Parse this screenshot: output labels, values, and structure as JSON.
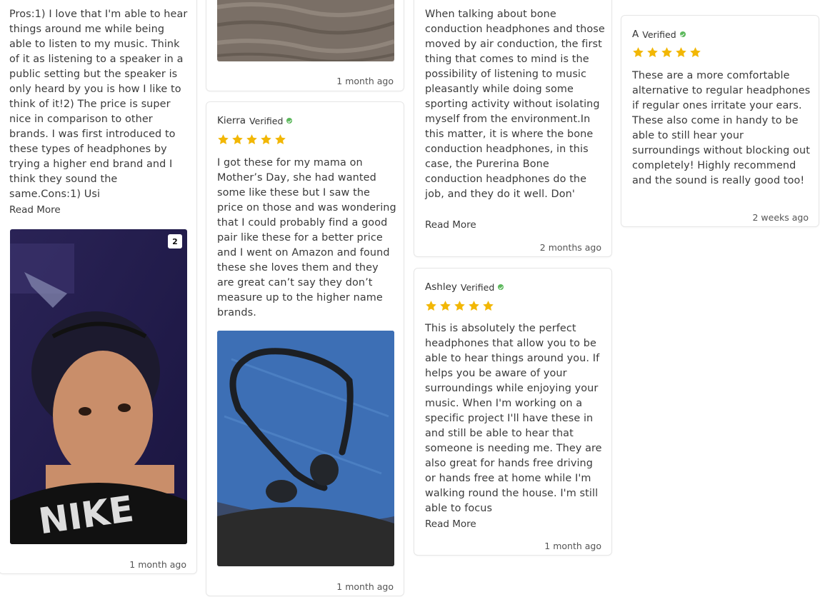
{
  "colors": {
    "star": "#f2b705",
    "verified": "#5cb85c",
    "border": "#e6e6e6"
  },
  "reviews": [
    {
      "text": "Pros:1) I love that I'm able to hear things around me while being able to listen to my music. Think of it as listening to a speaker in a public setting but the speaker is only heard by you is how I like to think of it!2) The price is super nice in comparison to other brands. I was first introduced to these types of headphones by trying a higher end brand and I think they sound the same.Cons:1) Usi",
      "read_more": "Read More",
      "photo_count": "2",
      "date": "1 month ago"
    },
    {
      "date": "1 month ago"
    },
    {
      "author": "Kierra",
      "verified": "Verified",
      "rating": 5,
      "text": "I got these for my mama on Mother’s Day, she had wanted some like these but I saw the price on those and was wondering that I could probably find a good pair like these for a better price and I went on Amazon and found these she loves them and they are great can’t say they don’t measure up to the higher name brands.",
      "date": "1 month ago"
    },
    {
      "text": "When talking about bone conduction headphones and those moved by air conduction, the first thing that comes to mind is the possibility of listening to music pleasantly while doing some sporting activity without isolating myself from the environment.In this matter, it is where the bone conduction headphones, in this case, the Purerina Bone conduction headphones do the job, and they do it well. Don'",
      "read_more": "Read More",
      "date": "2 months ago"
    },
    {
      "author": "Ashley",
      "verified": "Verified",
      "rating": 5,
      "text": "This is absolutely the perfect headphones that allow you to be able to hear things around you. If helps you be aware of your surroundings while enjoying your music. When I'm working on a specific project I'll have these in and still be able to hear that someone is needing me. They are also great for hands free driving or hands free at home while I'm walking round the house. I'm still able to focus",
      "read_more": "Read More",
      "date": "1 month ago"
    },
    {
      "author": "A",
      "verified": "Verified",
      "rating": 5,
      "text": "These are a more comfortable alternative to regular headphones if regular ones irritate your ears. These also come in handy to be able to still hear your surroundings without blocking out completely! Highly recommend and the sound is really good too!",
      "date": "2 weeks ago"
    }
  ]
}
